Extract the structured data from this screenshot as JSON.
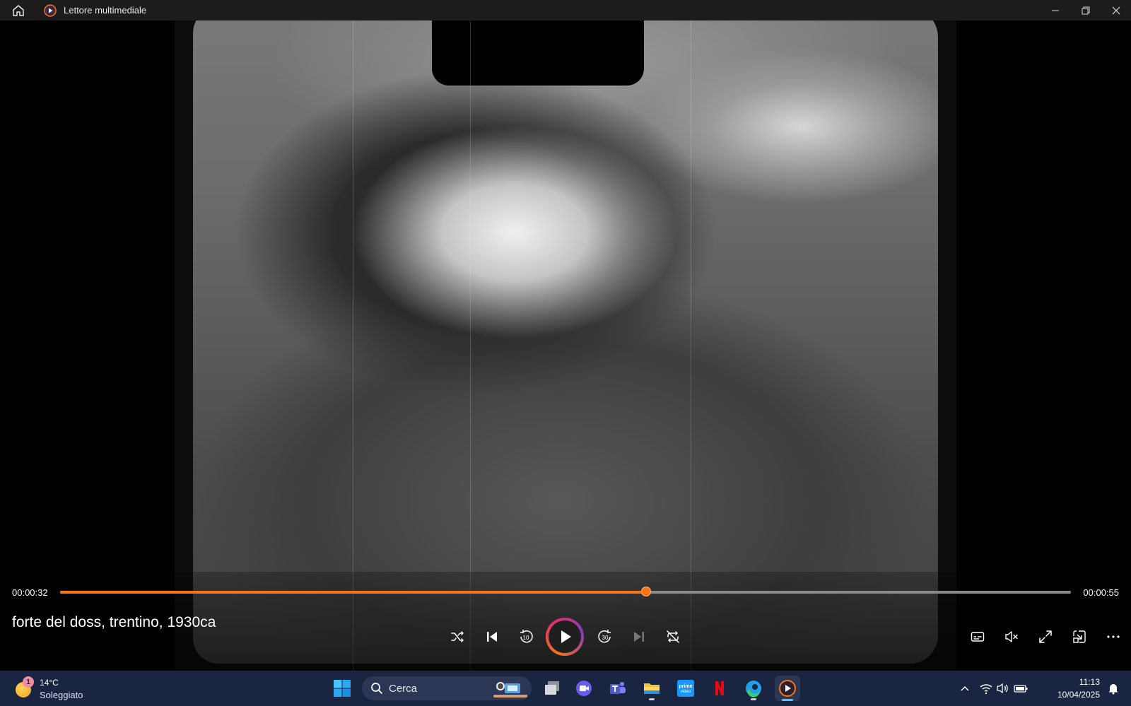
{
  "titlebar": {
    "app_title": "Lettore multimediale",
    "icons": {
      "home": "home-icon",
      "app": "media-player-icon",
      "minimize": "minimize-icon",
      "maximize": "restore-icon",
      "close": "close-icon"
    }
  },
  "player": {
    "current_time": "00:00:32",
    "total_time": "00:00:55",
    "progress": 0.58,
    "media_title": "forte del doss, trentino, 1930ca",
    "accent_color": "#f7731c",
    "controls": [
      "shuffle-icon",
      "previous-icon",
      "rewind-10-icon",
      "play-icon",
      "forward-30-icon",
      "next-icon",
      "repeat-off-icon"
    ],
    "right_controls": [
      "subtitles-icon",
      "mute-icon",
      "fullscreen-icon",
      "miniplayer-icon",
      "more-icon"
    ]
  },
  "taskbar": {
    "weather": {
      "badge": "1",
      "temp": "14°C",
      "desc": "Soleggiato"
    },
    "search_placeholder": "Cerca",
    "apps": [
      "windows-start-icon",
      "task-view-icon",
      "clipchamp-icon",
      "teams-icon",
      "file-explorer-icon",
      "prime-video-icon",
      "netflix-icon",
      "edge-icon",
      "media-player-icon"
    ],
    "clock_time": "11:13",
    "clock_date": "10/04/2025"
  }
}
